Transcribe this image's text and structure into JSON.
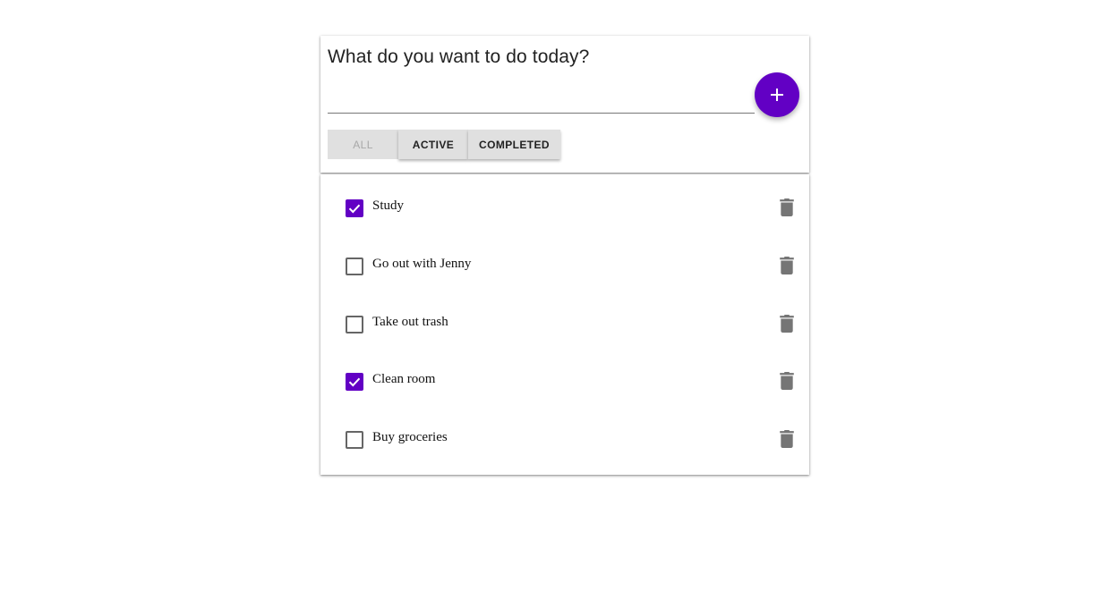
{
  "header": {
    "prompt": "What do you want to do today?"
  },
  "new_task": {
    "value": "",
    "placeholder": ""
  },
  "add_button": {
    "icon": "plus-icon"
  },
  "filters": [
    {
      "label": "ALL",
      "state": "disabled"
    },
    {
      "label": "ACTIVE",
      "state": "raised"
    },
    {
      "label": "COMPLETED",
      "state": "raised"
    }
  ],
  "todos": [
    {
      "label": "Study",
      "checked": true
    },
    {
      "label": "Go out with Jenny",
      "checked": false
    },
    {
      "label": "Take out trash",
      "checked": false
    },
    {
      "label": "Clean room",
      "checked": true
    },
    {
      "label": "Buy groceries",
      "checked": false
    }
  ],
  "colors": {
    "accent": "#6200c4",
    "icon_gray": "#757575"
  }
}
